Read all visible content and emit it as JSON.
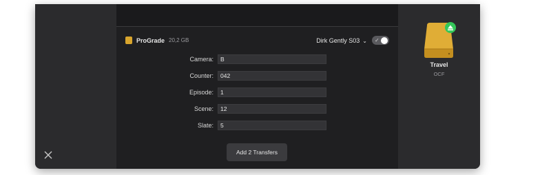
{
  "source": {
    "name": "ProGrade",
    "size": "20,2 GB"
  },
  "project": {
    "selected": "Dirk Gently S03",
    "toggle_on": true
  },
  "fields": [
    {
      "label": "Camera:",
      "value": "B"
    },
    {
      "label": "Counter:",
      "value": "042"
    },
    {
      "label": "Episode:",
      "value": "1"
    },
    {
      "label": "Scene:",
      "value": "12"
    },
    {
      "label": "Slate:",
      "value": "5"
    }
  ],
  "actions": {
    "add_label": "Add 2 Transfers"
  },
  "destination": {
    "name": "Travel",
    "subtitle": "OCF"
  },
  "colors": {
    "drive": "#d9a52d",
    "eject_badge": "#34c759"
  },
  "icons": {
    "close": "close-icon",
    "eject": "eject-icon",
    "drive": "drive-icon"
  }
}
